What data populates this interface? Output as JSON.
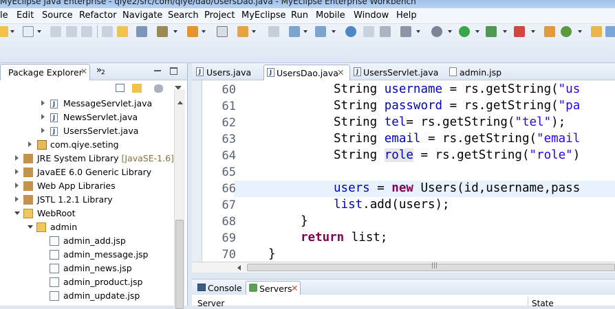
{
  "window": {
    "title": "MyEclipse Java Enterprise - qiye2/src/com/qiye/dao/UsersDao.java - MyEclipse Enterprise Workbench"
  },
  "menu": [
    "le",
    "Edit",
    "Source",
    "Refactor",
    "Navigate",
    "Search",
    "Project",
    "MyEclipse",
    "Run",
    "Mobile",
    "Window",
    "Help"
  ],
  "package_explorer": {
    "tab_label": "Package Explorer",
    "tab_close": "✕",
    "overflow_label": "»",
    "overflow_count": "2",
    "tree": [
      {
        "label": "MessageServlet.java",
        "suffix": ""
      },
      {
        "label": "NewsServlet.java",
        "suffix": ""
      },
      {
        "label": "UsersServlet.java",
        "suffix": ""
      },
      {
        "label": "com.qiye.seting",
        "suffix": ""
      },
      {
        "label": "JRE System Library",
        "suffix": "[JavaSE-1.6]"
      },
      {
        "label": "JavaEE 6.0 Generic Library",
        "suffix": ""
      },
      {
        "label": "Web App Libraries",
        "suffix": ""
      },
      {
        "label": "JSTL 1.2.1 Library",
        "suffix": ""
      },
      {
        "label": "WebRoot",
        "suffix": ""
      },
      {
        "label": "admin",
        "suffix": ""
      },
      {
        "label": "admin_add.jsp",
        "suffix": ""
      },
      {
        "label": "admin_message.jsp",
        "suffix": ""
      },
      {
        "label": "admin_news.jsp",
        "suffix": ""
      },
      {
        "label": "admin_product.jsp",
        "suffix": ""
      },
      {
        "label": "admin_update.jsp",
        "suffix": ""
      }
    ]
  },
  "editor": {
    "tabs": [
      {
        "label": "Users.java"
      },
      {
        "label": "UsersDao.java",
        "close": "✕"
      },
      {
        "label": "UsersServlet.java"
      },
      {
        "label": "admin.jsp"
      }
    ],
    "line_numbers": [
      "60",
      "61",
      "62",
      "63",
      "64",
      "65",
      "66",
      "67",
      "68",
      "69",
      "70"
    ],
    "code": {
      "l60": {
        "t1": "String ",
        "t2": "username",
        "t3": " = rs.getString(",
        "t4": "\"us"
      },
      "l61": {
        "t1": "String ",
        "t2": "password",
        "t3": " = rs.getString(",
        "t4": "\"pa"
      },
      "l62": {
        "t1": "String ",
        "t2": "tel",
        "t3": "= rs.getString(",
        "t4": "\"tel\"",
        "t5": ");"
      },
      "l63": {
        "t1": "String ",
        "t2": "email",
        "t3": " = rs.getString(",
        "t4": "\"email"
      },
      "l64": {
        "t1": "String ",
        "t2": "role",
        "t3": " = rs.getString(",
        "t4": "\"role\"",
        "t5": ")"
      },
      "l66": {
        "t1": "users",
        "t2": " = ",
        "t3": "new",
        "t4": " Users(id,username,pass"
      },
      "l67": {
        "t1": "list",
        "t2": ".add(users);"
      },
      "l68": {
        "t1": "}"
      },
      "l69": {
        "t1": "return",
        "t2": " list;"
      },
      "l70": {
        "t1": "}"
      }
    },
    "hscroll_grip": "|||"
  },
  "bottom_panel": {
    "tabs": [
      {
        "label": "Console"
      },
      {
        "label": "Servers",
        "close": "✕"
      }
    ],
    "columns": [
      "Server",
      "State"
    ]
  },
  "colors": {
    "keyword": "#7f0055",
    "field": "#0000c0",
    "string": "#2a00ff"
  }
}
